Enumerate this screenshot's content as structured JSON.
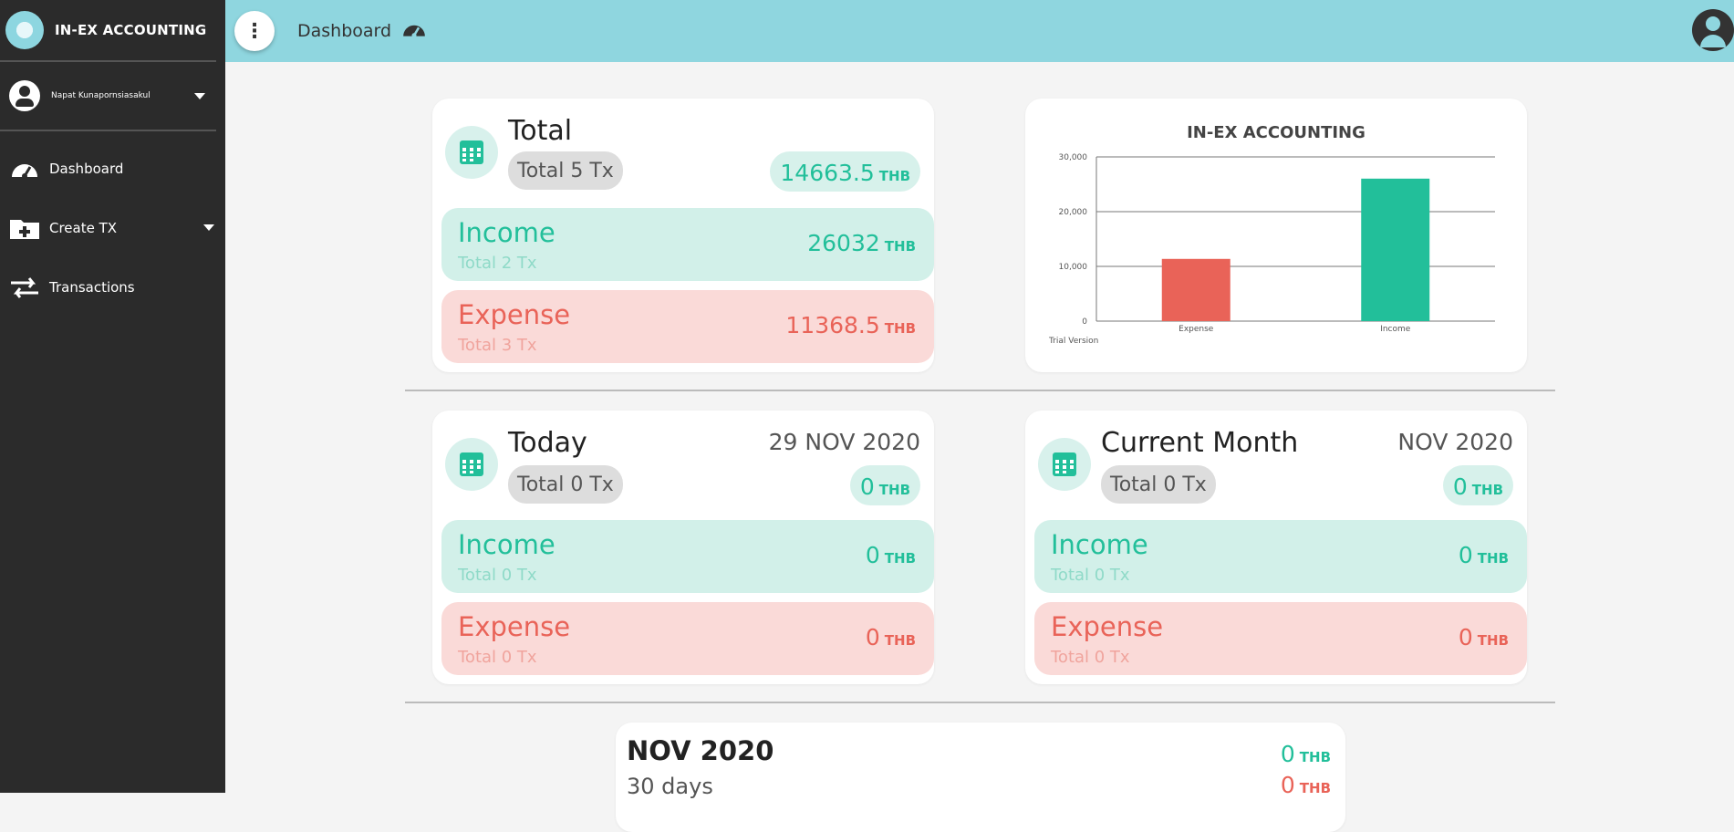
{
  "app": {
    "name": "IN-EX ACCOUNTING"
  },
  "sidebar": {
    "user": {
      "name": "Napat Kunapornsiasakul"
    },
    "items": [
      {
        "label": "Dashboard",
        "icon": "speedometer-icon"
      },
      {
        "label": "Create TX",
        "icon": "folder-plus-icon"
      },
      {
        "label": "Transactions",
        "icon": "swap-arrows-icon"
      }
    ]
  },
  "topbar": {
    "breadcrumb": "Dashboard"
  },
  "total_card": {
    "title": "Total",
    "tx_count": "Total 5 Tx",
    "amount": "14663.5",
    "currency": "THB",
    "income": {
      "label": "Income",
      "sub": "Total 2 Tx",
      "amount": "26032",
      "currency": "THB"
    },
    "expense": {
      "label": "Expense",
      "sub": "Total 3 Tx",
      "amount": "11368.5",
      "currency": "THB"
    }
  },
  "today_card": {
    "title": "Today",
    "date": "29 NOV 2020",
    "tx_count": "Total 0 Tx",
    "amount": "0",
    "currency": "THB",
    "income": {
      "label": "Income",
      "sub": "Total 0 Tx",
      "amount": "0",
      "currency": "THB"
    },
    "expense": {
      "label": "Expense",
      "sub": "Total 0 Tx",
      "amount": "0",
      "currency": "THB"
    }
  },
  "month_card": {
    "title": "Current Month",
    "date": "NOV 2020",
    "tx_count": "Total 0 Tx",
    "amount": "0",
    "currency": "THB",
    "income": {
      "label": "Income",
      "sub": "Total 0 Tx",
      "amount": "0",
      "currency": "THB"
    },
    "expense": {
      "label": "Expense",
      "sub": "Total 0 Tx",
      "amount": "0",
      "currency": "THB"
    }
  },
  "summary_card": {
    "title": "NOV 2020",
    "sub": "30 days",
    "income_amount": "0",
    "expense_amount": "0",
    "currency": "THB"
  },
  "colors": {
    "income": "#22bf9a",
    "expense": "#e96358",
    "topbar": "#8fd6df",
    "sidebar": "#2b2b2b"
  },
  "chart_data": {
    "type": "bar",
    "title": "IN-EX ACCOUNTING",
    "categories": [
      "Expense",
      "Income"
    ],
    "values": [
      11368.5,
      26032
    ],
    "colors": [
      "#e96358",
      "#22bf9a"
    ],
    "yticks": [
      0,
      10000,
      20000,
      30000
    ],
    "ytick_labels": [
      "0",
      "10,000",
      "20,000",
      "30,000"
    ],
    "ylim": [
      0,
      30000
    ],
    "legend": "none",
    "grid": true,
    "footnote": "Trial Version"
  }
}
